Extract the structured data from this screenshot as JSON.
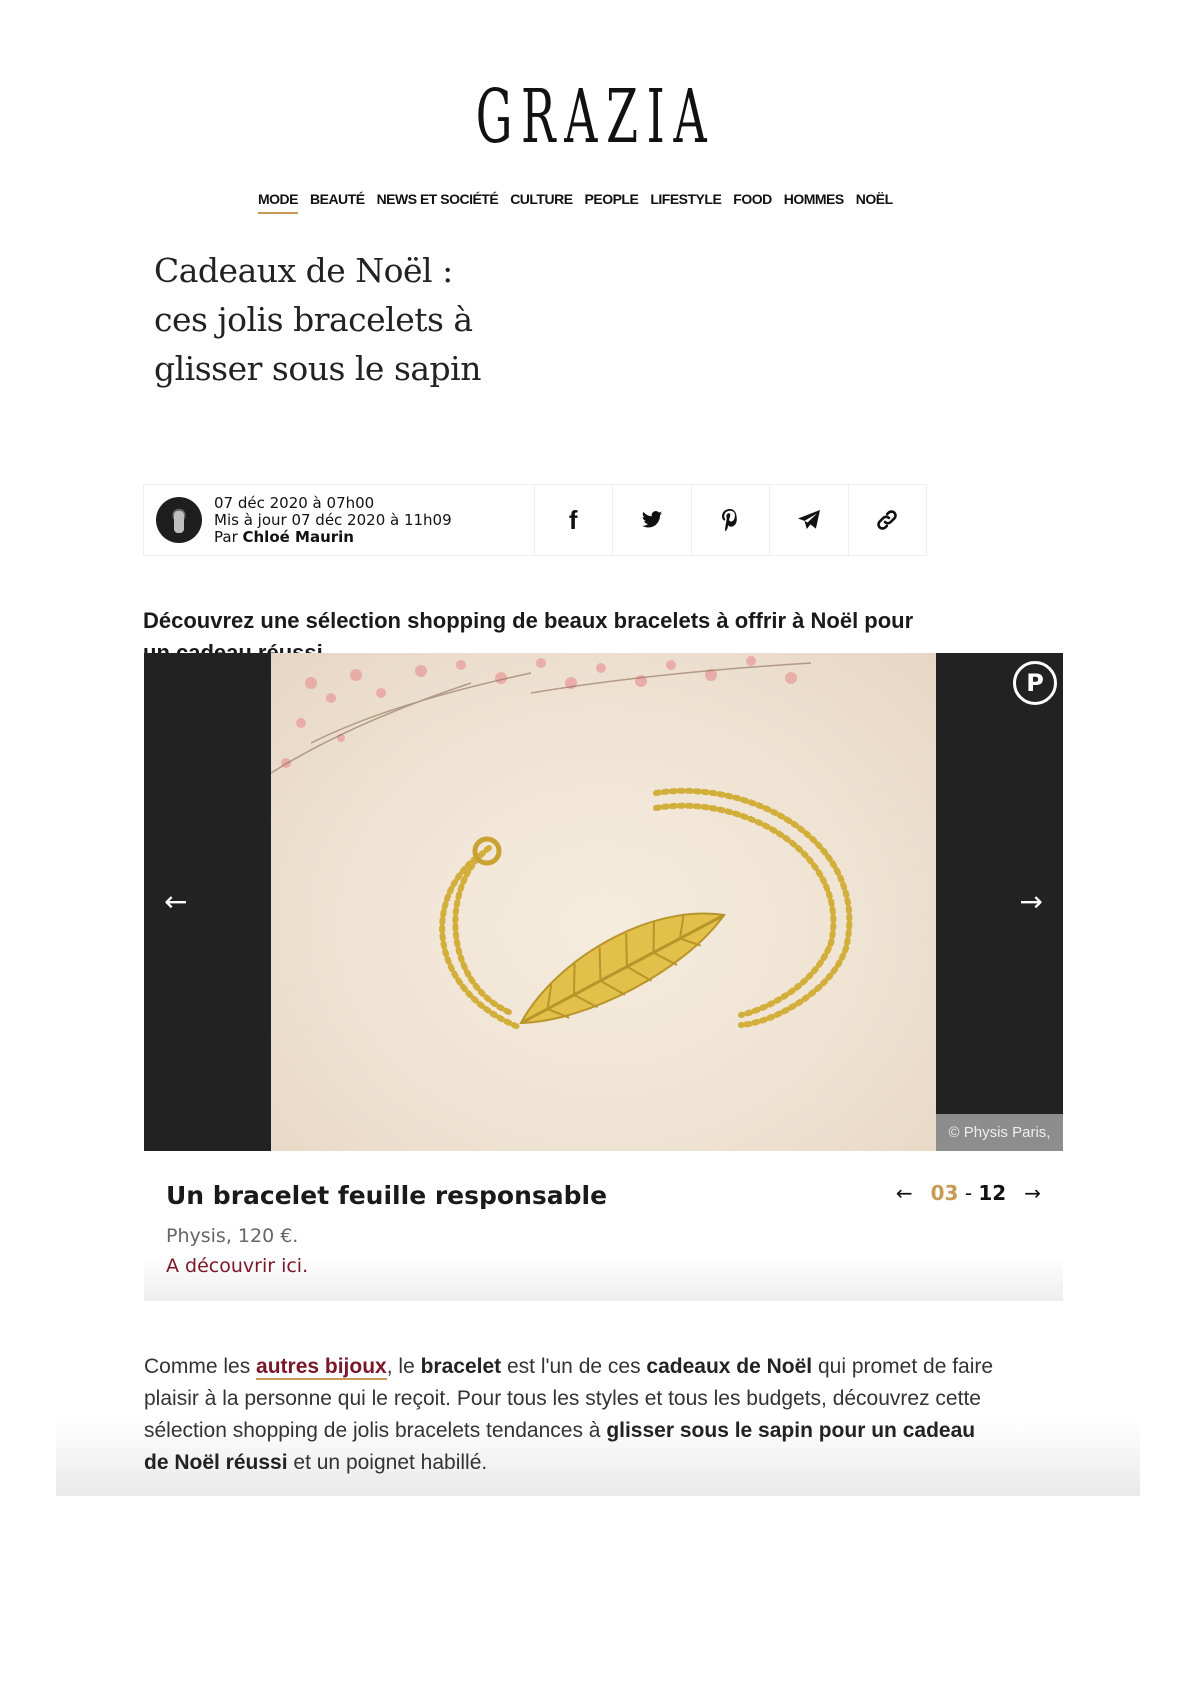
{
  "site": {
    "logo": "GRAZIA"
  },
  "nav": {
    "items": [
      {
        "label": "MODE",
        "active": true
      },
      {
        "label": "BEAUTÉ"
      },
      {
        "label": "NEWS ET SOCIÉTÉ"
      },
      {
        "label": "CULTURE"
      },
      {
        "label": "PEOPLE"
      },
      {
        "label": "LIFESTYLE"
      },
      {
        "label": "FOOD"
      },
      {
        "label": "HOMMES"
      },
      {
        "label": "NOËL"
      }
    ]
  },
  "article": {
    "title": "Cadeaux de Noël : ces jolis bracelets à glisser sous le sapin",
    "date": "07 déc 2020 à 07h00",
    "updated": "Mis à jour 07 déc 2020 à 11h09",
    "author_prefix": "Par ",
    "author": "Chloé Maurin",
    "intro": "Découvrez une sélection shopping de beaux bracelets à offrir à Noël pour un cadeau réussi."
  },
  "share": {
    "facebook": "f",
    "twitter": "🐦",
    "pinterest": "P",
    "telegram": "➤",
    "link": "🔗"
  },
  "slider": {
    "prev_arrow": "←",
    "next_arrow": "→",
    "pin_label": "P",
    "credit": "© Physis Paris,",
    "caption_title": "Un bracelet feuille responsable",
    "caption_sub": "Physis, 120 €.",
    "caption_link": "A découvrir ici.",
    "current": "03",
    "separator": "-",
    "total": "12"
  },
  "body": {
    "t1": "Comme les ",
    "link": "autres bijoux",
    "t2": ", le ",
    "b1": "bracelet",
    "t3": " est l'un de ces ",
    "b2": "cadeaux de Noël",
    "t4": " qui promet de faire plaisir à la personne qui le reçoit. Pour tous les styles et tous les budgets, découvrez cette sélection shopping de jolis bracelets tendances à ",
    "b3": "glisser sous le sapin pour un cadeau de Noël réussi",
    "t5": " et un poignet habillé."
  }
}
